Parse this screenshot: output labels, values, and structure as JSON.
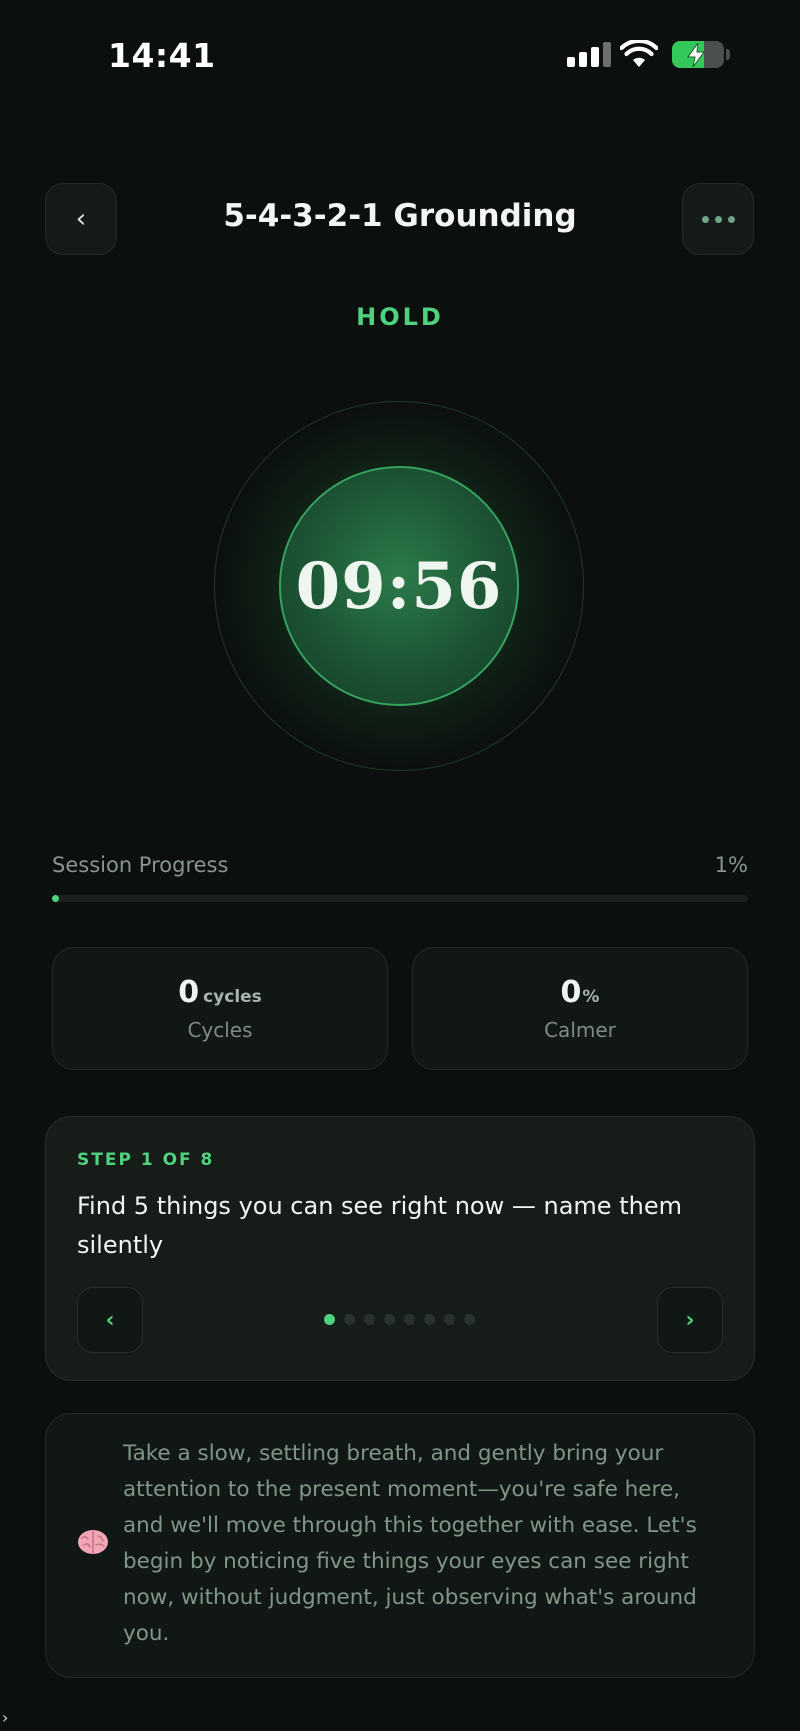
{
  "status_bar": {
    "time": "14:41",
    "battery_level": 0.62,
    "icons": [
      "cellular-signal-icon",
      "wifi-icon",
      "battery-charging-icon"
    ]
  },
  "header": {
    "back_label": "‹",
    "title": "5-4-3-2-1 Grounding",
    "more_icon": "more-dots-icon"
  },
  "breathing": {
    "phase": "HOLD",
    "timer": "09:56"
  },
  "progress": {
    "label": "Session Progress",
    "percent_text": "1%",
    "value": 0.01
  },
  "stats": {
    "cycles": {
      "value": "0",
      "unit": "cycles",
      "label": "Cycles"
    },
    "calmer": {
      "value": "0",
      "unit": "%",
      "label": "Calmer"
    }
  },
  "step": {
    "label": "STEP 1 OF 8",
    "text": "Find 5 things you can see right now — name them silently",
    "prev_label": "‹",
    "next_label": "›",
    "current": 1,
    "total": 8
  },
  "guidance": {
    "icon": "brain-icon",
    "text": "Take a slow, settling breath, and gently bring your attention to the present moment—you're safe here, and we'll move through this together with ease. Let's begin by noticing five things your eyes can see right now, without judgment, just observing what's around you."
  },
  "colors": {
    "accent": "#4fd17e",
    "background": "#0b0f0d",
    "card": "#161d19"
  }
}
